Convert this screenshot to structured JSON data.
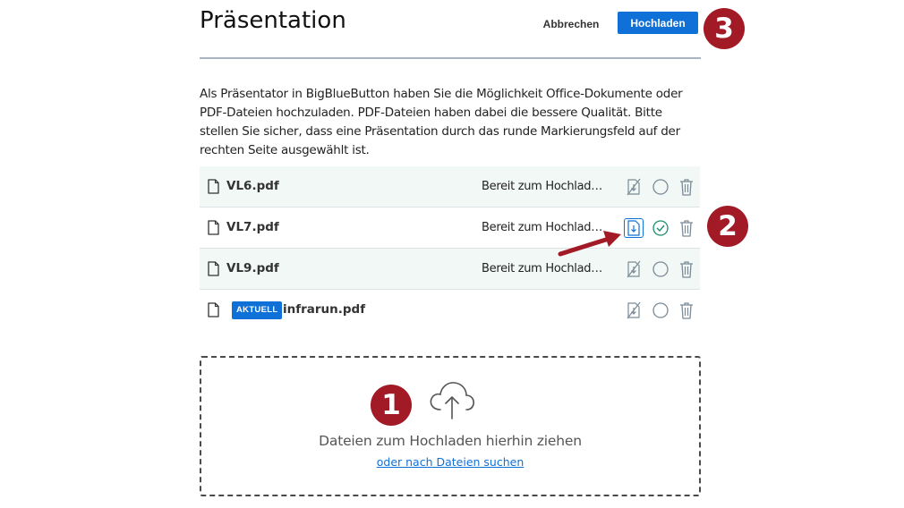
{
  "header": {
    "title": "Präsentation",
    "cancel_label": "Abbrechen",
    "upload_label": "Hochladen"
  },
  "intro": "Als Präsentator in BigBlueButton haben Sie die Möglichkeit Office-Dokumente oder PDF-Dateien hochzuladen. PDF-Dateien haben dabei die bessere Qualität. Bitte stellen Sie sicher, dass eine Präsentation durch das runde Markierungsfeld auf der rechten Seite ausgewählt ist.",
  "files": [
    {
      "name": "VL6.pdf",
      "status": "Bereit zum Hochladen...",
      "download_enabled": false,
      "selected": false
    },
    {
      "name": "VL7.pdf",
      "status": "Bereit zum Hochladen...",
      "download_enabled": true,
      "selected": true
    },
    {
      "name": "VL9.pdf",
      "status": "Bereit zum Hochladen...",
      "download_enabled": false,
      "selected": false
    },
    {
      "name": "infrarun.pdf",
      "badge": "AKTUELL",
      "current": true,
      "download_enabled": false,
      "selected": false
    }
  ],
  "dropzone": {
    "text": "Dateien zum Hochladen hierhin ziehen",
    "link": "oder nach Dateien suchen"
  },
  "annotations": [
    "1",
    "2",
    "3"
  ],
  "colors": {
    "accent": "#0f70d7",
    "annotation": "#a11a26",
    "row_background": "#f1f8f6",
    "check": "#1a8f6e"
  },
  "icons": {
    "file": "document-icon",
    "download": "download-document-icon",
    "select": "radio-check-icon",
    "delete": "trash-icon",
    "upload": "cloud-upload-icon"
  }
}
